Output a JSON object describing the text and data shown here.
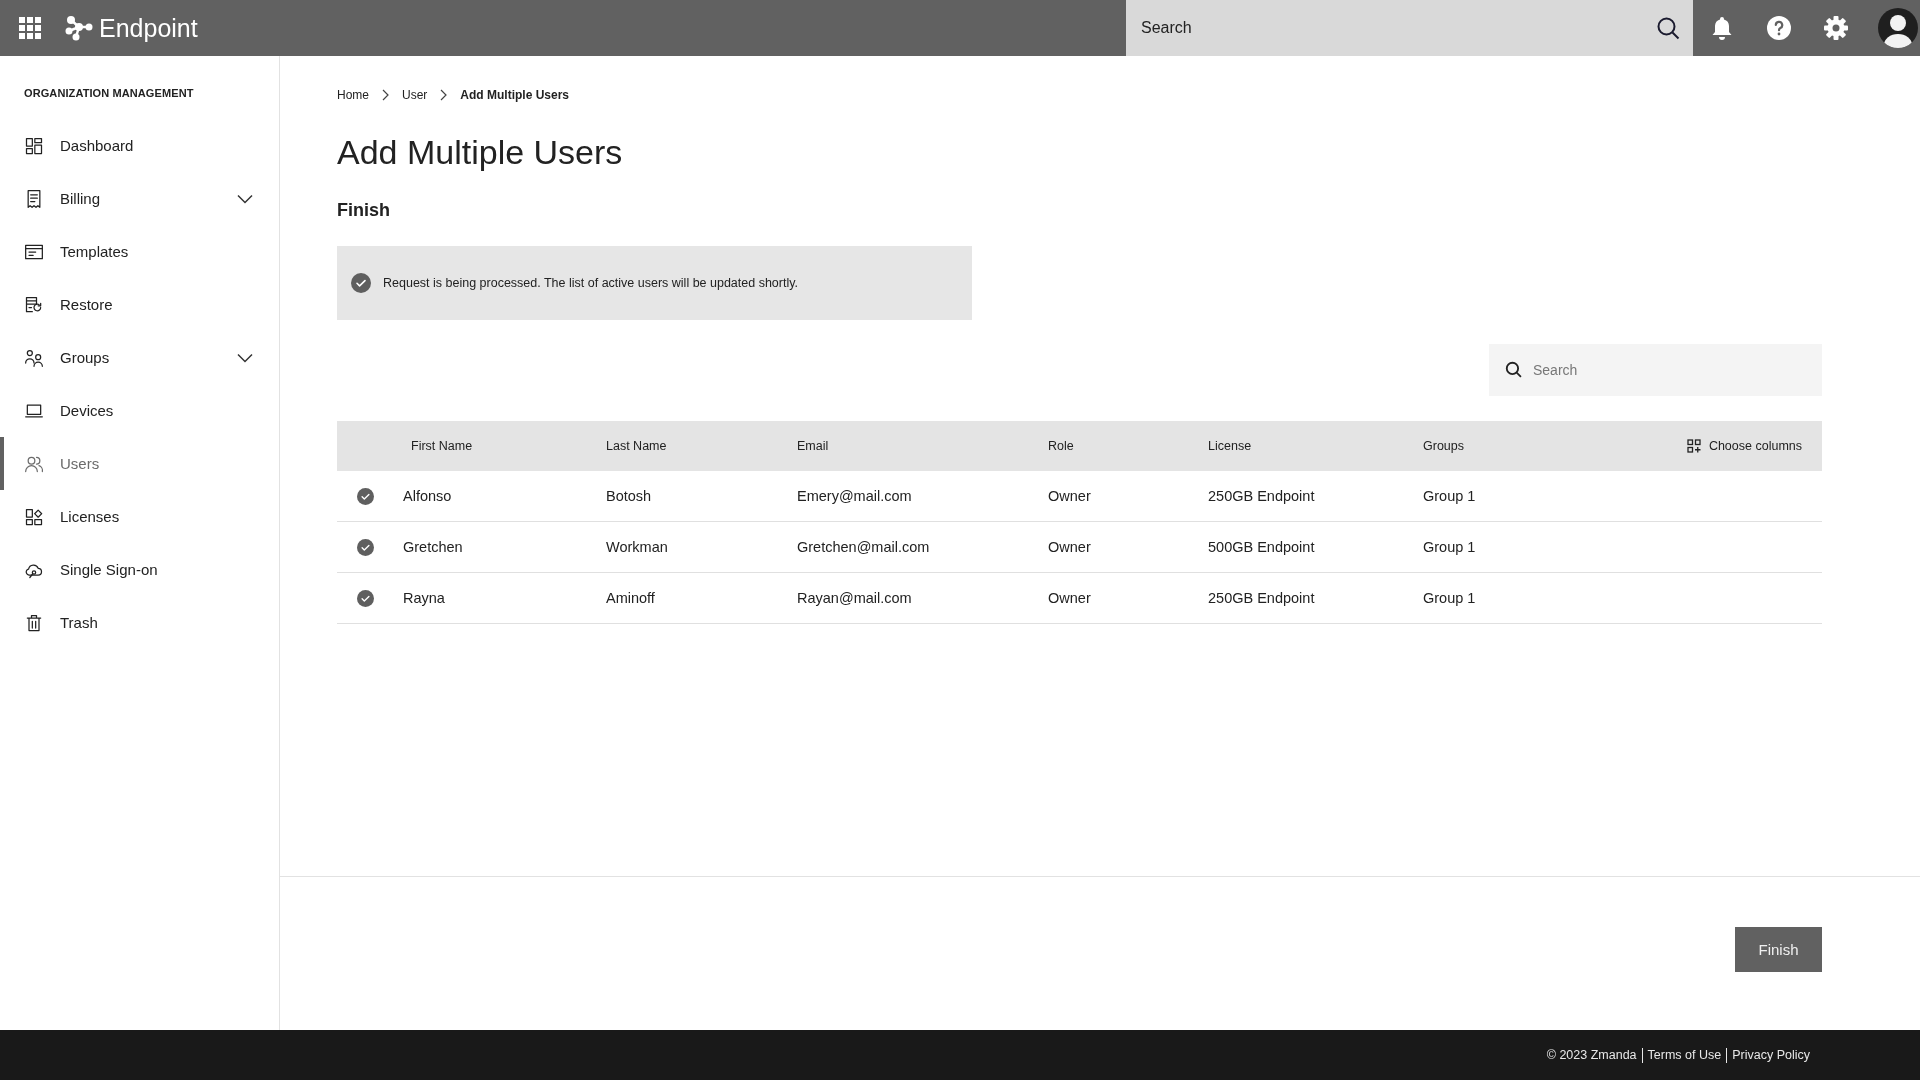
{
  "header": {
    "brand": "Endpoint",
    "search": {
      "placeholder": "Search"
    }
  },
  "sidebar": {
    "heading": "ORGANIZATION MANAGEMENT",
    "items": [
      {
        "label": "Dashboard",
        "kind": "dashboard",
        "has_submenu": false,
        "selected": false
      },
      {
        "label": "Billing",
        "kind": "receipt",
        "has_submenu": true,
        "selected": false
      },
      {
        "label": "Templates",
        "kind": "template",
        "has_submenu": false,
        "selected": false
      },
      {
        "label": "Restore",
        "kind": "restore",
        "has_submenu": false,
        "selected": false
      },
      {
        "label": "Groups",
        "kind": "group",
        "has_submenu": true,
        "selected": false
      },
      {
        "label": "Devices",
        "kind": "laptop",
        "has_submenu": false,
        "selected": false
      },
      {
        "label": "Users",
        "kind": "users",
        "has_submenu": false,
        "selected": true
      },
      {
        "label": "Licenses",
        "kind": "license",
        "has_submenu": false,
        "selected": false
      },
      {
        "label": "Single Sign-on",
        "kind": "cloud",
        "has_submenu": false,
        "selected": false
      },
      {
        "label": "Trash",
        "kind": "trash",
        "has_submenu": false,
        "selected": false
      }
    ]
  },
  "breadcrumb": [
    {
      "label": "Home",
      "current": false
    },
    {
      "label": "User",
      "current": false
    },
    {
      "label": "Add Multiple Users",
      "current": true
    }
  ],
  "title": "Add Multiple Users",
  "step_title": "Finish",
  "alert": {
    "text": "Request is being processed. The list of active users will be updated shortly."
  },
  "table": {
    "search": {
      "placeholder": "Search"
    },
    "columns": [
      "First Name",
      "Last Name",
      "Email",
      "Role",
      "License",
      "Groups"
    ],
    "choose_columns": "Choose columns",
    "rows": [
      {
        "processed": true,
        "cells": [
          "Alfonso",
          "Botosh",
          "Emery@mail.com",
          "Owner",
          "250GB Endpoint",
          "Group 1"
        ]
      },
      {
        "processed": true,
        "cells": [
          "Gretchen",
          "Workman",
          "Gretchen@mail.com",
          "Owner",
          "500GB Endpoint",
          "Group 1"
        ]
      },
      {
        "processed": true,
        "cells": [
          "Rayna",
          "Aminoff",
          "Rayan@mail.com",
          "Owner",
          "250GB Endpoint",
          "Group 1"
        ]
      }
    ]
  },
  "finish_button": "Finish",
  "footer": {
    "copyright": "© 2023 Zmanda",
    "links": [
      "Terms of Use",
      "Privacy Policy"
    ]
  }
}
